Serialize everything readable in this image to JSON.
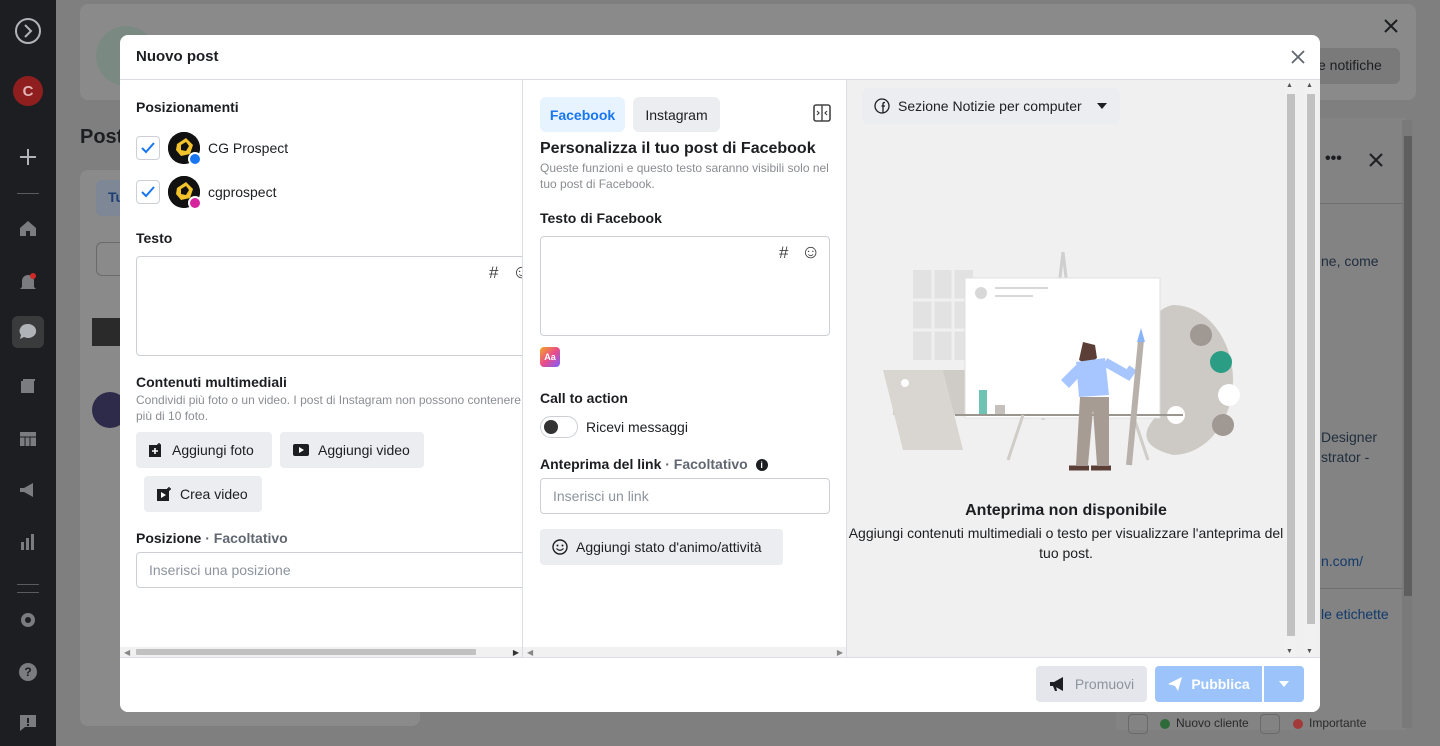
{
  "background": {
    "header_button": "e notifiche",
    "page_title": "Post",
    "tab_short": "Tu",
    "side_text_1": "ne, come",
    "side_text_2": "Designer",
    "side_text_3": "strator -",
    "side_link_1": "n.com/",
    "side_link_2": "le etichette",
    "label_1": "Nuovo cliente",
    "label_2": "Importante",
    "colors": {
      "label_1": "#1b9e3e",
      "label_2": "#d1262e"
    }
  },
  "modal": {
    "title": "Nuovo post",
    "placements": {
      "label": "Posizionamenti",
      "accounts": [
        {
          "name": "CG Prospect",
          "platform": "facebook",
          "checked": true
        },
        {
          "name": "cgprospect",
          "platform": "instagram",
          "checked": true
        }
      ]
    },
    "text": {
      "label": "Testo",
      "hashtag_icon": "#",
      "emoji_icon": "☺"
    },
    "media": {
      "label": "Contenuti multimediali",
      "helper": "Condividi più foto o un video. I post di Instagram non possono contenere più di 10 foto.",
      "add_photo": "Aggiungi foto",
      "add_video": "Aggiungi video",
      "create_video": "Crea video"
    },
    "position": {
      "label": "Posizione",
      "optional": " · Facoltativo",
      "placeholder": "Inserisci una posizione"
    },
    "tabs": [
      {
        "label": "Facebook",
        "active": true
      },
      {
        "label": "Instagram",
        "active": false
      }
    ],
    "customize": {
      "title": "Personalizza il tuo post di Facebook",
      "helper": "Queste funzioni e questo testo saranno visibili solo nel tuo post di Facebook."
    },
    "fb_text": {
      "label": "Testo di Facebook",
      "hashtag_icon": "#",
      "emoji_icon": "☺"
    },
    "cta": {
      "label": "Call to action",
      "toggle_label": "Ricevi messaggi",
      "enabled": false
    },
    "link_preview": {
      "label": "Anteprima del link",
      "optional": " · Facoltativo",
      "placeholder": "Inserisci un link"
    },
    "feeling_button": "Aggiungi stato d'animo/attività",
    "preview": {
      "dropdown": "Sezione Notizie per computer",
      "title": "Anteprima non disponibile",
      "description": "Aggiungi contenuti multimediali o testo per visualizzare l'anteprima del tuo post."
    },
    "footer": {
      "promote": "Promuovi",
      "publish": "Pubblica"
    }
  }
}
